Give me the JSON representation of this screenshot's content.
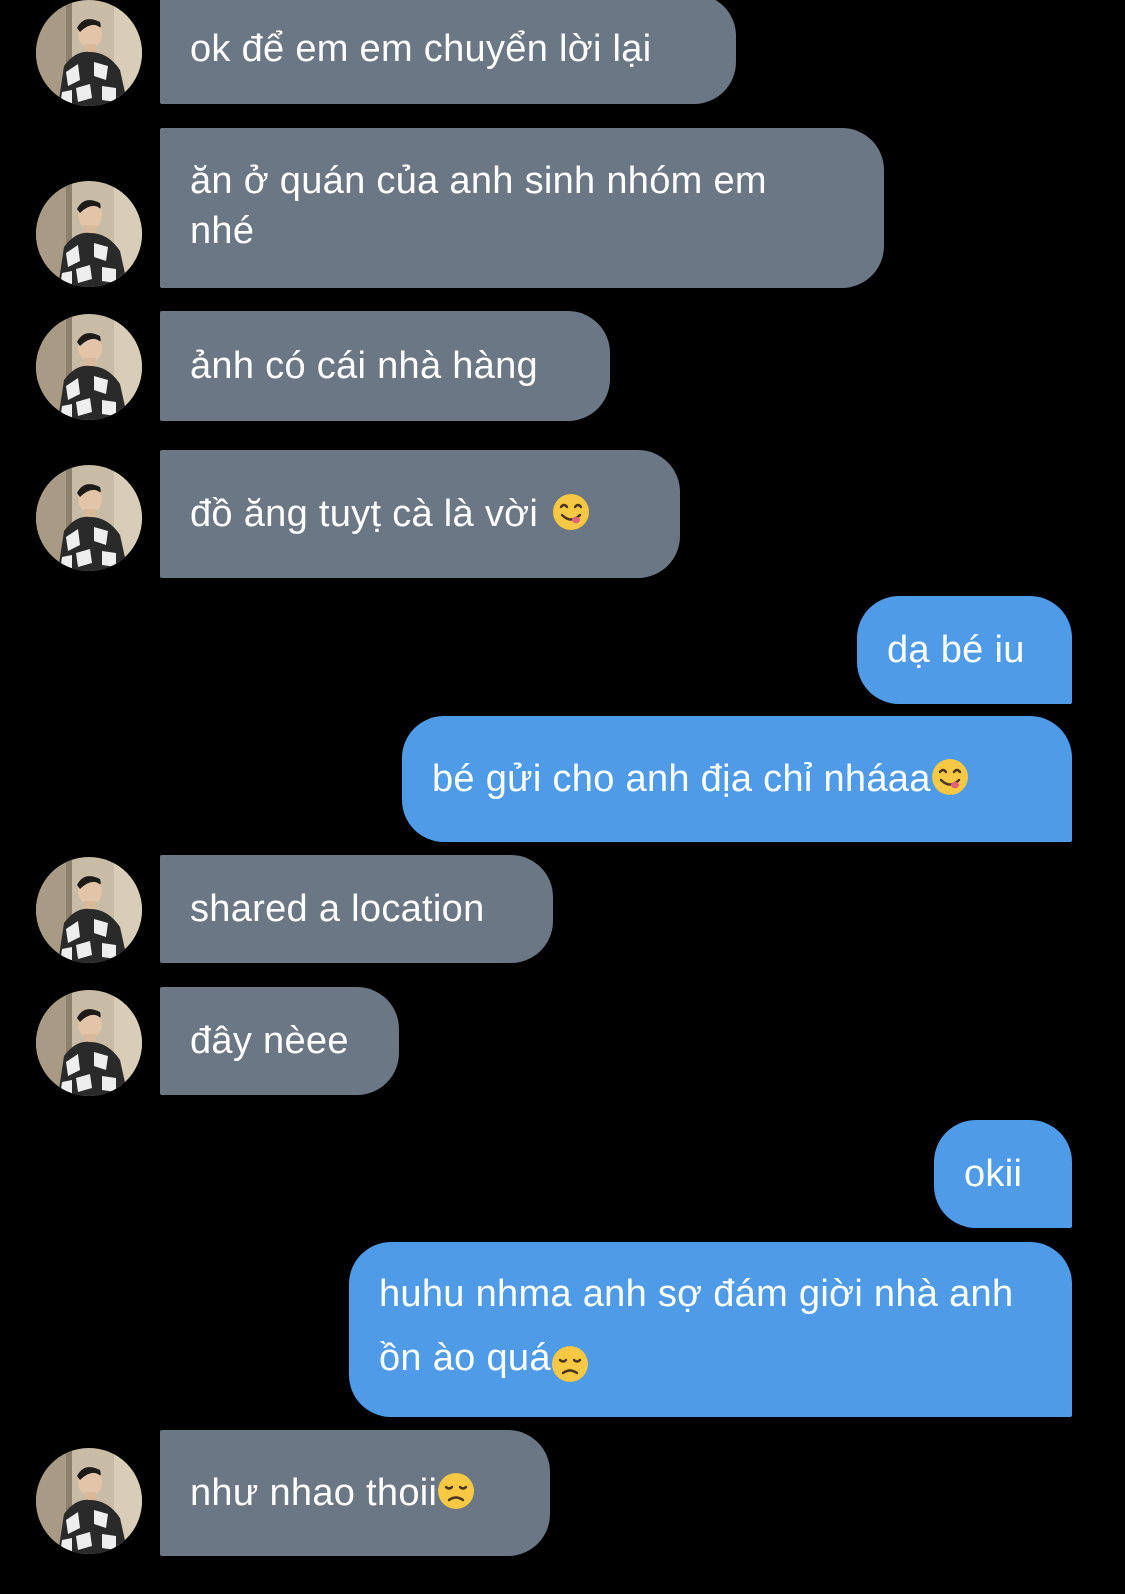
{
  "messages": [
    {
      "dir": "in",
      "text": "ok để em em chuyển lời lại",
      "avatar": true
    },
    {
      "dir": "in",
      "text": "ăn ở quán của anh sinh nhóm em nhé",
      "avatar": true
    },
    {
      "dir": "in",
      "text": "ảnh có cái nhà hàng",
      "avatar": true
    },
    {
      "dir": "in",
      "text": "đồ ăng tuyṭ cà là vời",
      "avatar": true,
      "emoji": "yum-face-emoji"
    },
    {
      "dir": "out",
      "text": "dạ bé iu"
    },
    {
      "dir": "out",
      "text": "bé gửi cho anh địa chỉ nháaa",
      "emoji": "yum-face-emoji"
    },
    {
      "dir": "in",
      "text": "shared a location",
      "avatar": true
    },
    {
      "dir": "in",
      "text": "đây nèee",
      "avatar": true
    },
    {
      "dir": "out",
      "text": "okii"
    },
    {
      "dir": "out",
      "text": "huhu nhma anh sợ đám giời nhà anh ồn ào quá",
      "emoji": "disappointed-face-emoji"
    },
    {
      "dir": "in",
      "text": "như nhao thoii",
      "avatar": true,
      "emoji": "disappointed-face-emoji"
    }
  ],
  "colors": {
    "background": "#000000",
    "incoming_bubble": "#6b7784",
    "outgoing_bubble": "#4f9be8",
    "text": "#ffffff"
  }
}
